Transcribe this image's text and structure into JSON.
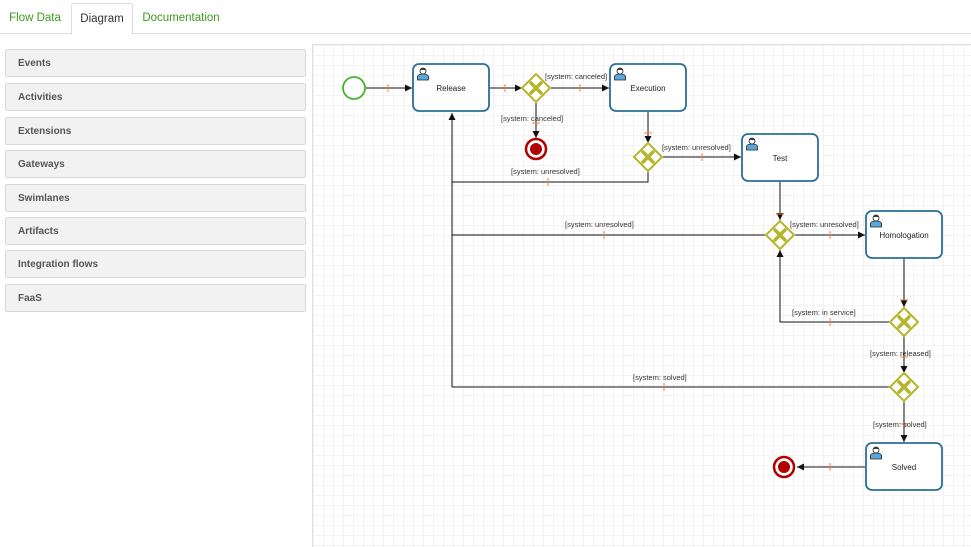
{
  "tabs": [
    {
      "label": "Flow Data"
    },
    {
      "label": "Diagram"
    },
    {
      "label": "Documentation"
    }
  ],
  "sidebar": {
    "items": [
      {
        "label": "Events"
      },
      {
        "label": "Activities"
      },
      {
        "label": "Extensions"
      },
      {
        "label": "Gateways"
      },
      {
        "label": "Swimlanes"
      },
      {
        "label": "Artifacts"
      },
      {
        "label": "Integration flows"
      },
      {
        "label": "FaaS"
      }
    ]
  },
  "diagram": {
    "tasks": {
      "release": "Release",
      "execution": "Execution",
      "test": "Test",
      "homologation": "Homologation",
      "solved": "Solved"
    },
    "edge_labels": {
      "canceled_1": "[system: canceled]",
      "canceled_2": "[system: canceled]",
      "unresolved_1": "[system: unresolved]",
      "unresolved_2": "[system: unresolved]",
      "unresolved_3": "[system: unresolved]",
      "unresolved_4": "[system: unresolved]",
      "in_service": "[system: in service]",
      "released": "[system: released]",
      "solved_1": "[system: solved]",
      "solved_2": "[system: solved]"
    },
    "colors": {
      "task_border": "#2a6f97",
      "start_event": "#4caf2c",
      "end_event": "#b00000",
      "gateway": "#b5b52a",
      "flow_marker": "#f08040"
    }
  }
}
